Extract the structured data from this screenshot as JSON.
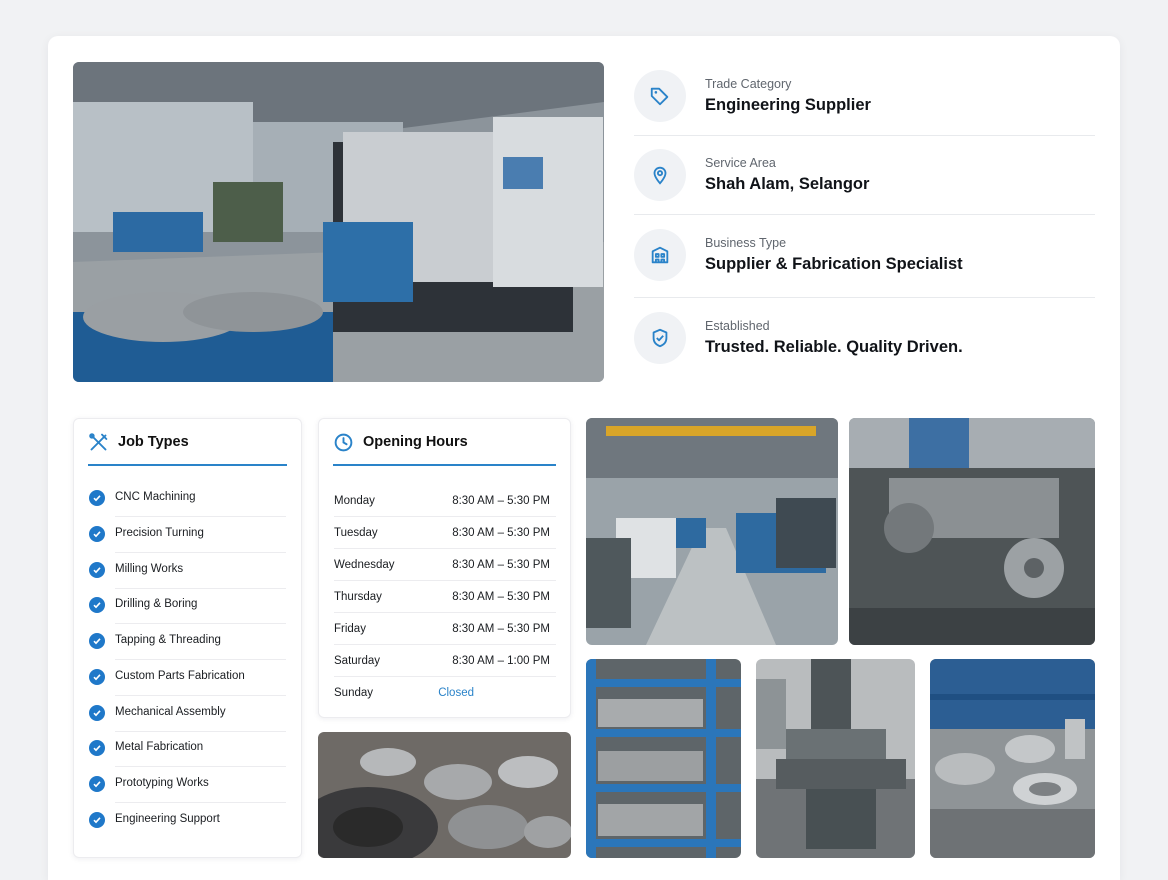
{
  "info": [
    {
      "label": "Trade Category",
      "value": "Engineering Supplier",
      "icon": "tag-icon"
    },
    {
      "label": "Service Area",
      "value": "Shah Alam, Selangor",
      "icon": "location-pin-icon"
    },
    {
      "label": "Business Type",
      "value": "Supplier & Fabrication Specialist",
      "icon": "building-icon"
    },
    {
      "label": "Established",
      "value": "Trusted. Reliable. Quality Driven.",
      "icon": "shield-check-icon"
    }
  ],
  "job_types": {
    "title": "Job Types",
    "items": [
      "CNC Machining",
      "Precision Turning",
      "Milling Works",
      "Drilling & Boring",
      "Tapping & Threading",
      "Custom Parts Fabrication",
      "Mechanical Assembly",
      "Metal Fabrication",
      "Prototyping Works",
      "Engineering Support"
    ]
  },
  "opening_hours": {
    "title": "Opening Hours",
    "rows": [
      {
        "day": "Monday",
        "time": "8:30 AM – 5:30 PM"
      },
      {
        "day": "Tuesday",
        "time": "8:30 AM – 5:30 PM"
      },
      {
        "day": "Wednesday",
        "time": "8:30 AM – 5:30 PM"
      },
      {
        "day": "Thursday",
        "time": "8:30 AM – 5:30 PM"
      },
      {
        "day": "Friday",
        "time": "8:30 AM – 5:30 PM"
      },
      {
        "day": "Saturday",
        "time": "8:30 AM – 1:00 PM"
      },
      {
        "day": "Sunday",
        "time": "Closed"
      }
    ]
  },
  "colors": {
    "accent": "#2a83c9",
    "check": "#1f78c9",
    "icon_bg": "#f0f2f5"
  }
}
